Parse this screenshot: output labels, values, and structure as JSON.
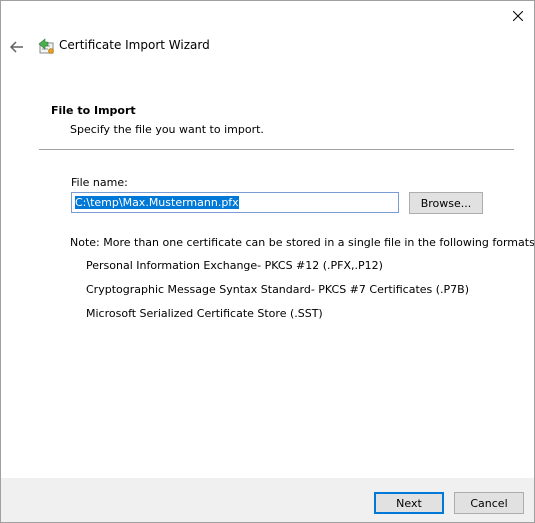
{
  "titlebar": {
    "close_icon": "close-icon"
  },
  "header": {
    "back_icon": "back-arrow-icon",
    "app_icon": "certificate-icon",
    "title": "Certificate Import Wizard"
  },
  "page": {
    "heading": "File to Import",
    "subheading": "Specify the file you want to import."
  },
  "file": {
    "label": "File name:",
    "value": "C:\\temp\\Max.Mustermann.pfx",
    "browse_label": "Browse..."
  },
  "note": {
    "text": "Note:  More than one certificate can be stored in a single file in the following formats:",
    "formats": [
      "Personal Information Exchange- PKCS #12 (.PFX,.P12)",
      "Cryptographic Message Syntax Standard- PKCS #7 Certificates (.P7B)",
      "Microsoft Serialized Certificate Store (.SST)"
    ]
  },
  "footer": {
    "next_label": "Next",
    "cancel_label": "Cancel"
  },
  "colors": {
    "accent": "#0078d7",
    "footer_bg": "#f0f0f0",
    "button_bg": "#e1e1e1"
  }
}
